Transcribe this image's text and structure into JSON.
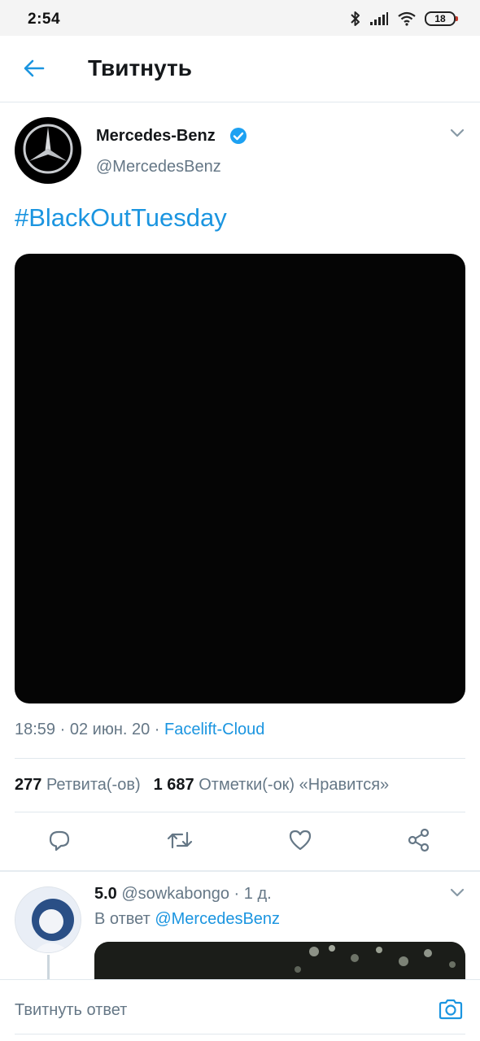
{
  "status_bar": {
    "time": "2:54",
    "battery": "18",
    "icons": [
      "bluetooth-icon",
      "signal-icon",
      "wifi-icon",
      "battery-icon"
    ]
  },
  "header": {
    "title": "Твитнуть",
    "back_icon": "arrow-left-icon"
  },
  "tweet": {
    "author_name": "Mercedes-Benz",
    "author_handle": "@MercedesBenz",
    "verified": true,
    "text": "#BlackOutTuesday",
    "media": "black-image",
    "time": "18:59",
    "sep1": " · ",
    "date": "02 июн. 20",
    "sep2": " · ",
    "source": "Facelift-Cloud",
    "retweets_count": "277",
    "retweets_label": "Ретвита(-ов)",
    "likes_count": "1 687",
    "likes_label": "Отметки(-ок) «Нравится»",
    "actions": [
      "reply-icon",
      "retweet-icon",
      "like-icon",
      "share-icon"
    ]
  },
  "reply": {
    "name": "5.0",
    "handle": "@sowkabongo",
    "dot": " · ",
    "age": "1 д.",
    "reply_prefix": "В ответ ",
    "reply_mention": "@MercedesBenz"
  },
  "compose": {
    "placeholder": "Твитнуть ответ",
    "camera_icon": "camera-icon"
  },
  "colors": {
    "accent": "#1b95e0",
    "text_primary": "#14171a",
    "text_secondary": "#657786",
    "divider": "#e1e8ed",
    "verified": "#1da1f2"
  }
}
